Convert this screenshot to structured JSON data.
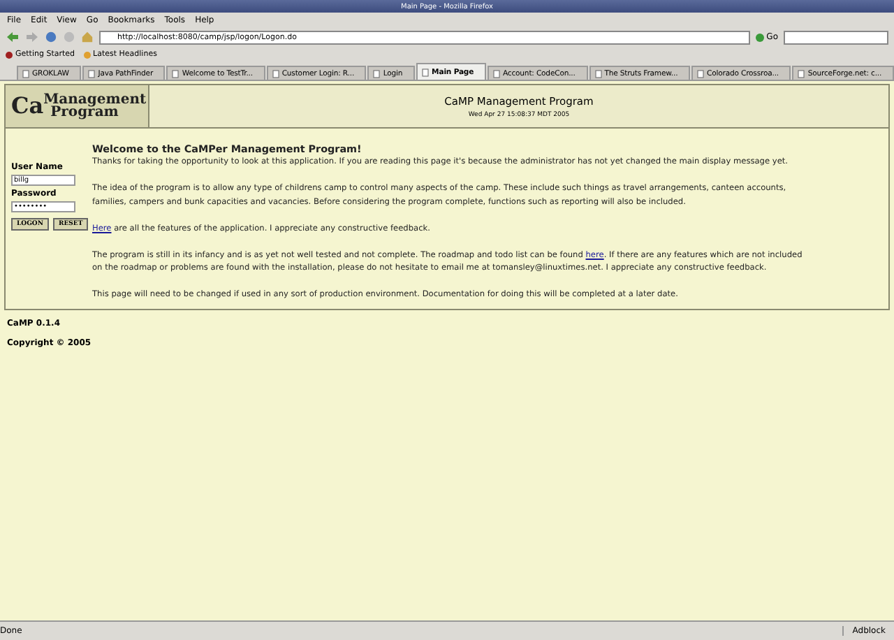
{
  "window": {
    "title": "Main Page - Mozilla Firefox"
  },
  "menu": [
    "File",
    "Edit",
    "View",
    "Go",
    "Bookmarks",
    "Tools",
    "Help"
  ],
  "address": {
    "value": "http://localhost:8080/camp/jsp/logon/Logon.do",
    "go": "Go"
  },
  "bookmarks": [
    "Getting Started",
    "Latest Headlines"
  ],
  "tabs": [
    {
      "label": "GROKLAW",
      "selected": false
    },
    {
      "label": "Java PathFinder",
      "selected": false
    },
    {
      "label": "Welcome to TestTr...",
      "selected": false
    },
    {
      "label": "Customer Login: R...",
      "selected": false
    },
    {
      "label": "Login",
      "selected": false
    },
    {
      "label": "Main Page",
      "selected": true
    },
    {
      "label": "Account: CodeCon...",
      "selected": false
    },
    {
      "label": "The Struts Framew...",
      "selected": false
    },
    {
      "label": "Colorado Crossroa...",
      "selected": false
    },
    {
      "label": "SourceForge.net: c...",
      "selected": false
    }
  ],
  "header": {
    "logo_left": "Ca",
    "logo_top": "Management",
    "logo_bottom": "Program",
    "title": "CaMP Management Program",
    "date": "Wed Apr 27 15:08:37 MDT 2005"
  },
  "login": {
    "user_label": "User Name",
    "user_value": "billg",
    "password_label": "Password",
    "password_value": "••••••••",
    "buttons": [
      "LOGON",
      "RESET"
    ]
  },
  "welcome": {
    "heading": "Welcome to the CaMPer Management Program!",
    "paragraphs": [
      [
        {
          "kind": "text",
          "text": "Thanks for taking the opportunity to look at this application. If you are reading this page it's because the administrator has not yet changed the main display message yet."
        }
      ],
      [
        {
          "kind": "text",
          "text": "The idea of the program is to allow any type of childrens camp to control many aspects of the camp. These include such things as travel arrangements, canteen accounts, families, campers and bunk capacities and vacancies. Before considering the program complete, functions such as reporting will also be included."
        }
      ],
      [
        {
          "kind": "link",
          "text": "Here"
        },
        {
          "kind": "text",
          "text": " are all the features of the application. I appreciate any constructive feedback."
        }
      ],
      [
        {
          "kind": "text",
          "text": "The program is still in its infancy and is as yet not well tested and not complete. The roadmap and todo list can be found "
        },
        {
          "kind": "link",
          "text": "here"
        },
        {
          "kind": "text",
          "text": ". If there are any features which are not included on the roadmap or problems are found with the installation, please do not hesitate to email me at tomansley@linuxtimes.net. I appreciate any constructive feedback."
        }
      ],
      [
        {
          "kind": "text",
          "text": "This page will need to be changed if used in any sort of production environment. Documentation for doing this will be completed at a later date."
        }
      ]
    ]
  },
  "footer": [
    "CaMP 0.1.4",
    "Copyright © 2005"
  ],
  "status_bar": {
    "text": "Done",
    "adblock": "Adblock"
  }
}
